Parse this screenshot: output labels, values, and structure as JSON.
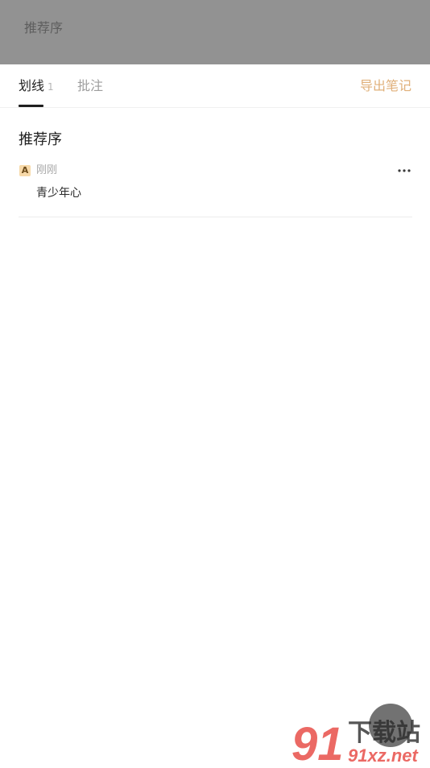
{
  "header": {
    "book_title": "推荐序"
  },
  "tabs": [
    {
      "label": "划线",
      "count": "1",
      "active": true
    },
    {
      "label": "批注",
      "active": false
    }
  ],
  "export_label": "导出笔记",
  "chapter": {
    "title": "推荐序"
  },
  "notes": [
    {
      "type_badge": "A",
      "time": "刚刚",
      "text": "青少年心"
    }
  ],
  "watermark": {
    "logo_text": "91",
    "cn_text": "下载站",
    "url_text": "91xz.net"
  },
  "colors": {
    "accent": "#e0b07a",
    "overlay": "#929292",
    "badge_bg": "#f7d9a9",
    "watermark_red": "#e8504a"
  },
  "icons": {
    "more": "more-horizontal-icon"
  }
}
